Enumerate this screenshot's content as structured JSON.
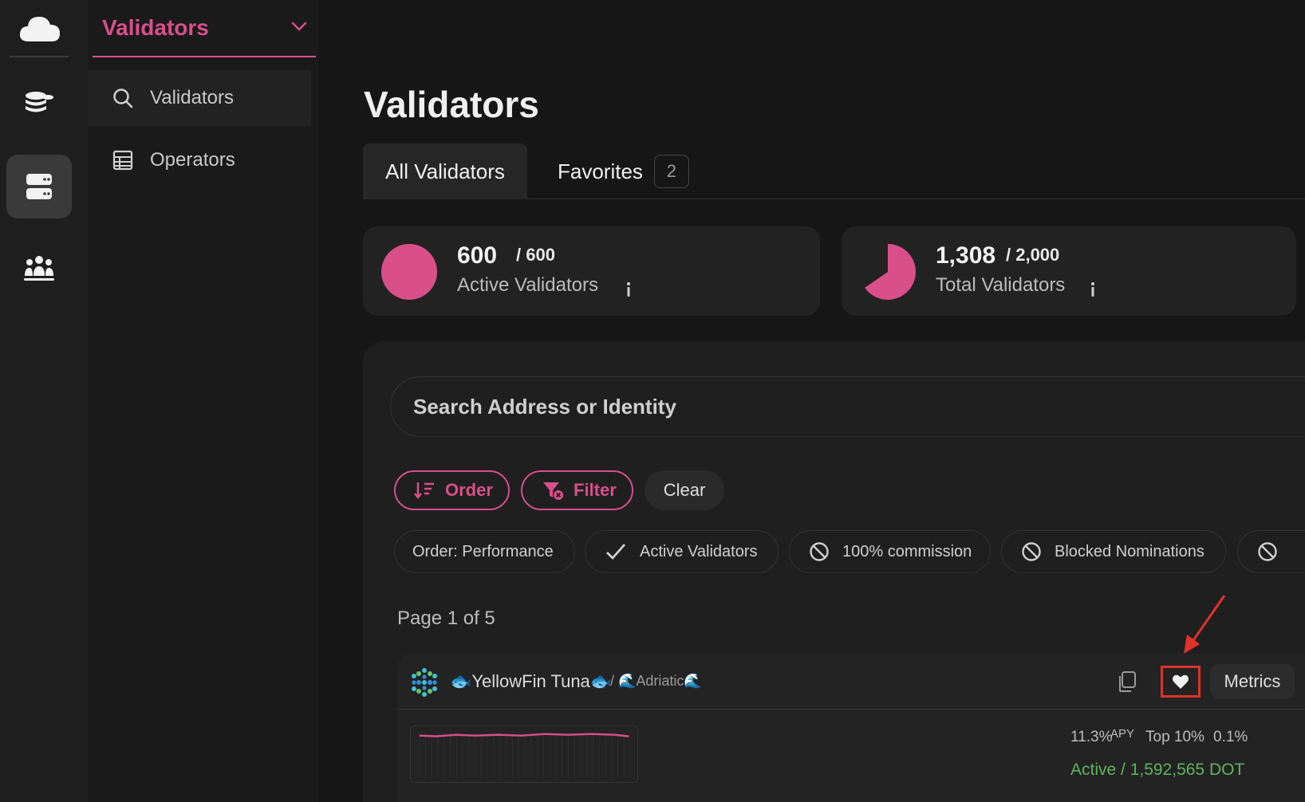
{
  "rail": {
    "items": [
      {
        "name": "staking",
        "icon": "coins-icon"
      },
      {
        "name": "validators",
        "icon": "server-icon",
        "active": true
      },
      {
        "name": "community",
        "icon": "people-icon"
      }
    ]
  },
  "sidebar": {
    "section": "Validators",
    "items": [
      {
        "label": "Validators",
        "icon": "search-icon"
      },
      {
        "label": "Operators",
        "icon": "table-icon"
      }
    ]
  },
  "main": {
    "title": "Validators",
    "tabs": [
      {
        "label": "All Validators"
      },
      {
        "label": "Favorites",
        "badge": "2"
      }
    ],
    "stats": [
      {
        "value": "600",
        "of": "/ 600",
        "label": "Active Validators",
        "fraction": 1.0,
        "color": "#d94f8a"
      },
      {
        "value": "1,308",
        "of": "/ 2,000",
        "label": "Total Validators",
        "fraction": 0.654,
        "color": "#d94f8a"
      }
    ],
    "search_placeholder": "Search Address or Identity",
    "buttons": {
      "order": "Order",
      "filter": "Filter",
      "clear": "Clear"
    },
    "chips": [
      "Order: Performance",
      "Active Validators",
      "100% commission",
      "Blocked Nominations"
    ],
    "page_info": "Page 1 of 5",
    "validator": {
      "name": "🐟YellowFin Tuna🐟",
      "parent": "/ 🌊Adriatic🌊",
      "metrics_label": "Metrics",
      "apy_value": "11.3%",
      "apy_label": "APY",
      "rank": "Top 10%",
      "commission": "0.1%",
      "status": "Active / 1,592,565 DOT"
    }
  }
}
